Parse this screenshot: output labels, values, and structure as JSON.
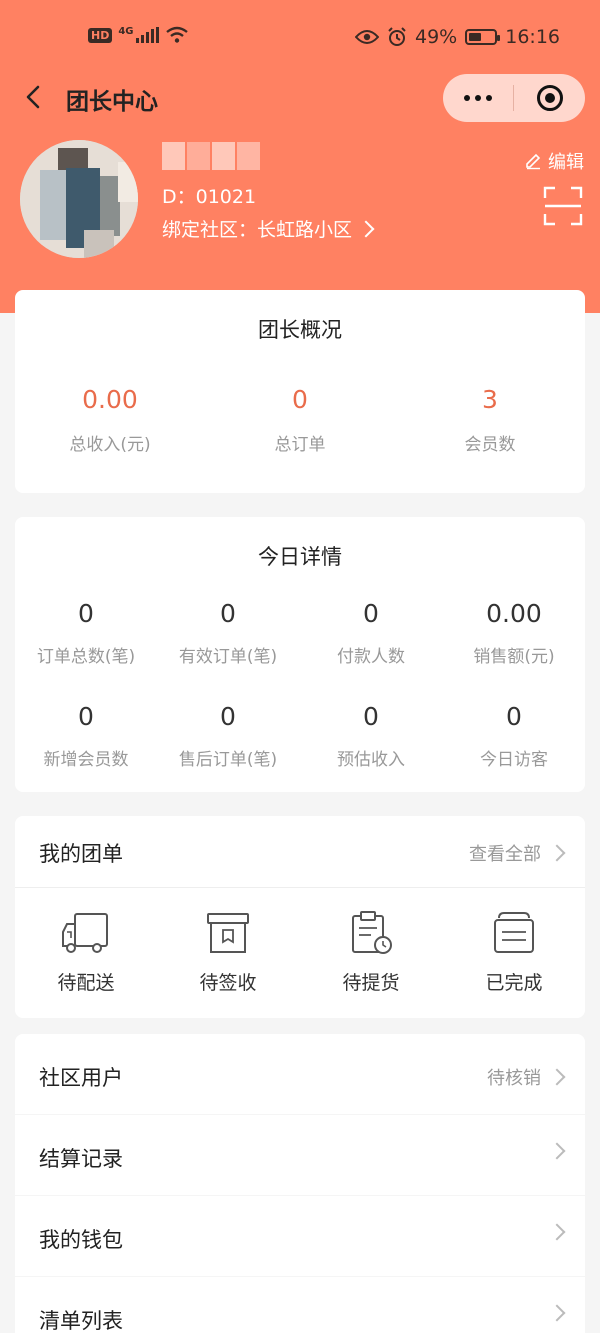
{
  "status_bar": {
    "network": "4G",
    "hd": "HD",
    "battery": "49%",
    "battery_level": 0.49,
    "time": "16:16",
    "icons": [
      "signal-icon",
      "wifi-icon",
      "eye-icon",
      "alarm-icon",
      "battery-icon"
    ]
  },
  "nav": {
    "title": "团长中心",
    "icons": [
      "back-arrow-icon",
      "more-dots-icon",
      "close-target-icon"
    ]
  },
  "profile": {
    "id_line": "D：01021",
    "community_label": "绑定社区：长虹路小区",
    "edit_label": "编辑",
    "icons": [
      "edit-pencil-icon",
      "scan-icon",
      "chevron-right-icon"
    ]
  },
  "overview": {
    "title": "团长概况",
    "stats": [
      {
        "value": "0.00",
        "label": "总收入(元)"
      },
      {
        "value": "0",
        "label": "总订单"
      },
      {
        "value": "3",
        "label": "会员数"
      }
    ]
  },
  "today": {
    "title": "今日详情",
    "stats": [
      {
        "value": "0",
        "label": "订单总数(笔)"
      },
      {
        "value": "0",
        "label": "有效订单(笔)"
      },
      {
        "value": "0",
        "label": "付款人数"
      },
      {
        "value": "0.00",
        "label": "销售额(元)"
      },
      {
        "value": "0",
        "label": "新增会员数"
      },
      {
        "value": "0",
        "label": "售后订单(笔)"
      },
      {
        "value": "0",
        "label": "预估收入"
      },
      {
        "value": "0",
        "label": "今日访客"
      }
    ]
  },
  "orders": {
    "title": "我的团单",
    "view_all": "查看全部",
    "items": [
      {
        "label": "待配送",
        "icon": "truck-icon"
      },
      {
        "label": "待签收",
        "icon": "box-icon"
      },
      {
        "label": "待提货",
        "icon": "clipboard-clock-icon"
      },
      {
        "label": "已完成",
        "icon": "stack-tray-icon"
      }
    ]
  },
  "menu": [
    {
      "label": "社区用户",
      "right": "待核销"
    },
    {
      "label": "结算记录",
      "right": ""
    },
    {
      "label": "我的钱包",
      "right": ""
    },
    {
      "label": "清单列表",
      "right": ""
    }
  ],
  "colors": {
    "header": "#ff8162",
    "accent_value": "#e96c4b",
    "capsule": "#ffd7cd"
  }
}
